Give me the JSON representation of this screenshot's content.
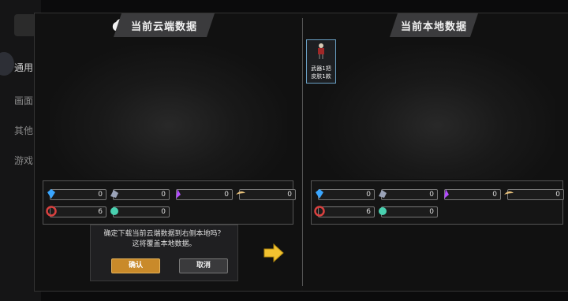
{
  "settings_bg": {
    "items": [
      "通用",
      "画面",
      "其他",
      "游戏"
    ]
  },
  "left_pane": {
    "title": "当前云端数据",
    "stats": [
      {
        "icon": "gem-blue-icon",
        "color": "#3aa6ff",
        "value": "0"
      },
      {
        "icon": "ore-gray-icon",
        "color": "#9aa3b8",
        "value": "0"
      },
      {
        "icon": "crystal-purple-icon",
        "color": "#b44cff",
        "value": "0"
      },
      {
        "icon": "feather-quill-icon",
        "color": "#e8c17a",
        "value": "0"
      },
      {
        "icon": "red-token-icon",
        "color": "#d9413f",
        "value": "6"
      },
      {
        "icon": "green-orb-icon",
        "color": "#49d1b0",
        "value": "0"
      }
    ]
  },
  "right_pane": {
    "title": "当前本地数据",
    "item": {
      "line1": "武器1把",
      "line2": "皮肤1款"
    },
    "stats": [
      {
        "icon": "gem-blue-icon",
        "color": "#3aa6ff",
        "value": "0"
      },
      {
        "icon": "ore-gray-icon",
        "color": "#9aa3b8",
        "value": "0"
      },
      {
        "icon": "crystal-purple-icon",
        "color": "#b44cff",
        "value": "0"
      },
      {
        "icon": "feather-quill-icon",
        "color": "#e8c17a",
        "value": "0"
      },
      {
        "icon": "red-token-icon",
        "color": "#d9413f",
        "value": "6"
      },
      {
        "icon": "green-orb-icon",
        "color": "#49d1b0",
        "value": "0"
      }
    ]
  },
  "confirm": {
    "line1": "确定下载当前云端数据到右侧本地吗？",
    "line2": "这将覆盖本地数据。",
    "ok_label": "确认",
    "cancel_label": "取消"
  },
  "colors": {
    "accent_yellow": "#f2c230",
    "ok_orange": "#c98a2a"
  }
}
